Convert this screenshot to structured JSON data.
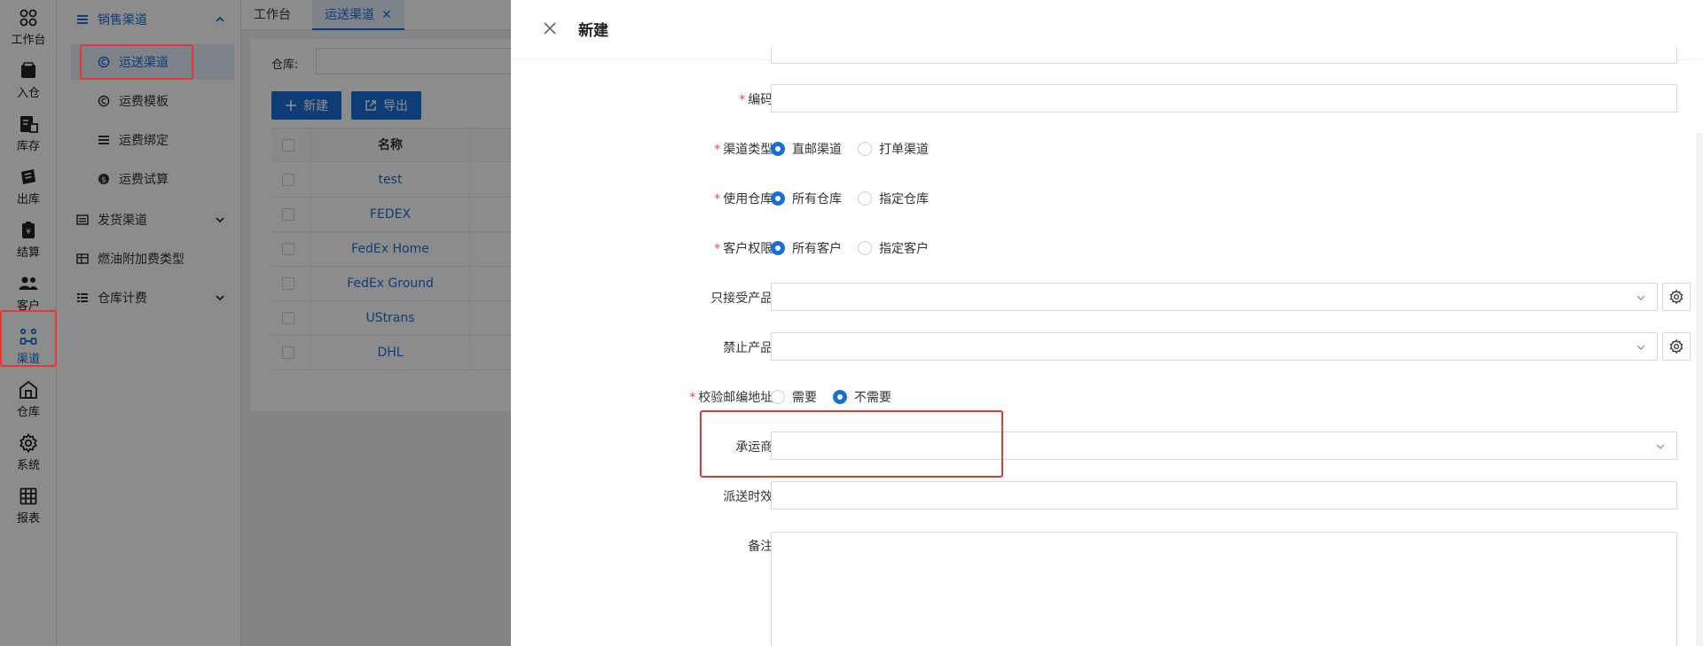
{
  "rail": [
    {
      "label": "工作台",
      "icon": "workbench-icon"
    },
    {
      "label": "入仓",
      "icon": "inbound-icon"
    },
    {
      "label": "库存",
      "icon": "inventory-icon"
    },
    {
      "label": "出库",
      "icon": "outbound-icon"
    },
    {
      "label": "结算",
      "icon": "settlement-icon"
    },
    {
      "label": "客户",
      "icon": "customers-icon"
    },
    {
      "label": "渠道",
      "icon": "channel-icon"
    },
    {
      "label": "仓库",
      "icon": "warehouse-icon"
    },
    {
      "label": "系统",
      "icon": "gear-icon"
    },
    {
      "label": "报表",
      "icon": "report-icon"
    }
  ],
  "subnav": {
    "sales_group": "销售渠道",
    "items": [
      "运送渠道",
      "运费模板",
      "运费绑定",
      "运费试算"
    ],
    "ship_group": "发货渠道",
    "fuel": "燃油附加费类型",
    "storage_group": "仓库计费"
  },
  "tabs": {
    "home": "工作台",
    "active": "运送渠道"
  },
  "filter": {
    "warehouse_label": "仓库:"
  },
  "toolbar": {
    "new_label": "新建",
    "export_label": "导出"
  },
  "table": {
    "header": "名称",
    "rows": [
      "test",
      "FEDEX",
      "FedEx Home",
      "FedEx Ground",
      "UStrans",
      "DHL"
    ]
  },
  "drawer": {
    "title": "新建",
    "code_label": "编码:",
    "channel_type_label": "渠道类型:",
    "channel_type_options": [
      "直邮渠道",
      "打单渠道"
    ],
    "warehouse_use_label": "使用仓库:",
    "warehouse_use_options": [
      "所有仓库",
      "指定仓库"
    ],
    "customer_perm_label": "客户权限:",
    "customer_perm_options": [
      "所有客户",
      "指定客户"
    ],
    "accept_products_label": "只接受产品:",
    "forbid_products_label": "禁止产品:",
    "verify_zip_label": "校验邮编地址:",
    "verify_zip_options": [
      "需要",
      "不需要"
    ],
    "carrier_label": "承运商:",
    "delivery_time_label": "派送时效:",
    "remark_label": "备注:"
  },
  "colors": {
    "accent": "#1a6fd6",
    "highlight": "#e53935",
    "required": "#e74c3c"
  }
}
